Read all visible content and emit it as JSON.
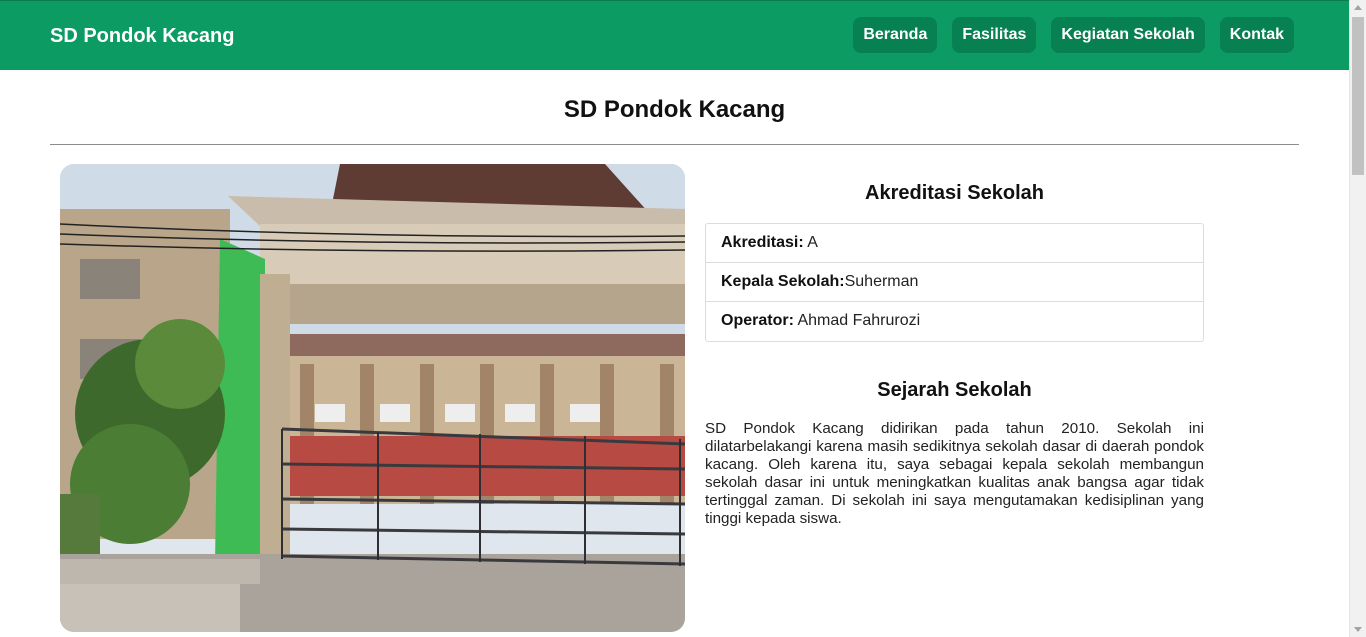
{
  "navbar": {
    "brand": "SD Pondok Kacang",
    "links": [
      "Beranda",
      "Fasilitas",
      "Kegiatan Sekolah",
      "Kontak"
    ],
    "color": "#0c9c63",
    "button_color": "#088152"
  },
  "page": {
    "title": "SD Pondok Kacang"
  },
  "accreditation": {
    "heading": "Akreditasi Sekolah",
    "rows": [
      {
        "label": "Akreditasi:",
        "value": " A"
      },
      {
        "label": "Kepala Sekolah:",
        "value": "Suherman"
      },
      {
        "label": "Operator:",
        "value": " Ahmad Fahrurozi"
      }
    ]
  },
  "history": {
    "heading": "Sejarah Sekolah",
    "text": "SD Pondok Kacang didirikan pada tahun 2010. Sekolah ini dilatarbelakangi karena masih sedikitnya sekolah dasar di daerah pondok kacang. Oleh karena itu, saya sebagai kepala sekolah membangun sekolah dasar ini untuk meningkatkan kualitas anak bangsa agar tidak tertinggal zaman. Di sekolah ini saya mengutamakan kedisiplinan yang tinggi kepada siswa."
  }
}
